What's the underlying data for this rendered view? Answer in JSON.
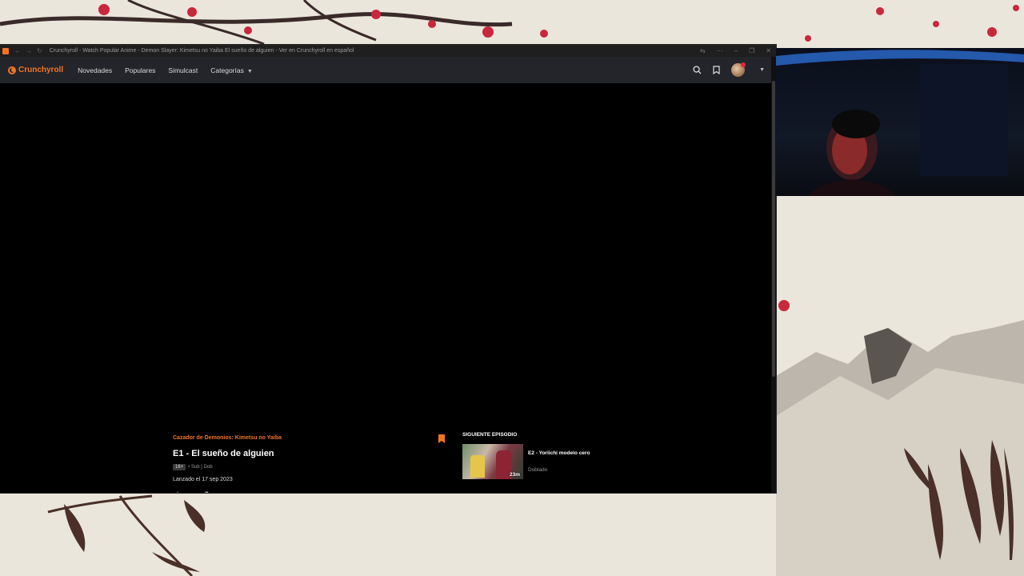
{
  "window": {
    "title": "Crunchyroll - Watch Popular Anime - Demon Slayer: Kimetsu no Yaiba El sueño de alguien - Ver en Crunchyroll en español"
  },
  "navbar": {
    "logo": "Crunchyroll",
    "links": [
      "Novedades",
      "Populares",
      "Simulcast",
      "Categorías"
    ]
  },
  "episode": {
    "series": "Cazador de Demonios: Kimetsu no Yaiba",
    "title": "E1 - El sueño de alguien",
    "rating": "16+",
    "audio": "• Sub | Dob",
    "release": "Lanzado el 17 sep 2023"
  },
  "next": {
    "label": "SIGUIENTE EPISODIO",
    "title": "E2 - Yoriichi modelo cero",
    "duration": "23m",
    "subtitle": "Doblado"
  },
  "icons": {
    "search": "search-icon",
    "bookmark": "bookmark-icon",
    "avatar": "avatar",
    "caret": "chevron-down-icon"
  },
  "colors": {
    "accent": "#f47521",
    "navbar": "#23252b",
    "player": "#000000"
  }
}
